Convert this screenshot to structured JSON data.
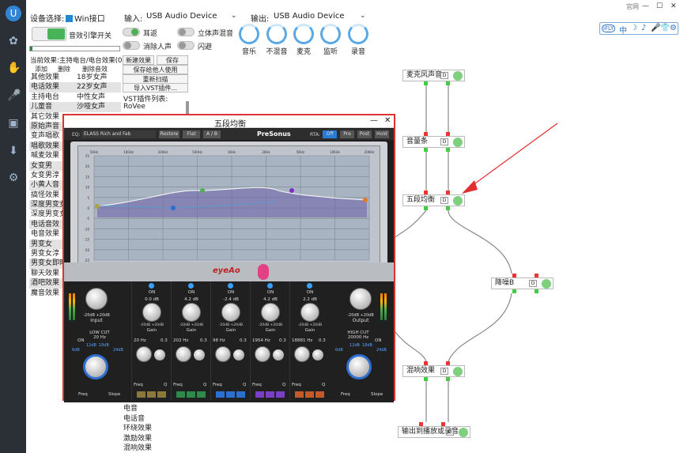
{
  "header": {
    "device_label": "设备选择:",
    "win_interface": "Win接口",
    "input_label": "输入:",
    "input_device": "USB Audio Device",
    "output_label": "输出:",
    "output_device": "USB Audio Device",
    "website_link": "官网"
  },
  "engine": {
    "switch_label": "音效引擎开关",
    "enabled": true
  },
  "toggles": [
    {
      "label": "耳返",
      "on": true
    },
    {
      "label": "立体声混音",
      "on": false
    },
    {
      "label": "消除人声",
      "on": false
    },
    {
      "label": "闪避",
      "on": false
    }
  ],
  "knobs": [
    "音乐",
    "不混音",
    "麦克",
    "监听",
    "录音"
  ],
  "progress": 0.03,
  "current_effect": {
    "label": "当前效果:",
    "value": "主持电台/电台效果(04)"
  },
  "effect_actions": [
    "添加",
    "删除",
    "删除音效"
  ],
  "plugin_buttons": {
    "new_effect": "新建效果",
    "save": "保存",
    "save_for_others": "保存给他人使用",
    "rescan": "重新扫描",
    "import_vst": "导入VST插件...",
    "vst_list_label": "VST插件列表:",
    "vst_first": "RoVee"
  },
  "effects_col1": [
    "其他效果",
    "电话效果",
    "主持电台",
    "儿童音",
    "其它效果",
    "原始声音",
    "变声唱歌",
    "唱歌效果",
    "喊麦效果",
    "女变男",
    "女变男淳",
    "小黄人音",
    "搞怪效果",
    "深度男变女",
    "深度男变女",
    "电话音效",
    "电音效果",
    "男变女",
    "男变女淳",
    "男变女即时",
    "聊天效果",
    "酒吧效果",
    "魔音效果"
  ],
  "effects_col2": [
    "18岁女声",
    "22岁女声",
    "中性女声",
    "沙哑女声"
  ],
  "effects_list2_bottom": [
    "电音",
    "电话音",
    "环绕效果",
    "激励效果",
    "混响效果"
  ],
  "top_tools": {
    "brand": "iFLY",
    "items": [
      "中",
      "☽",
      "♪",
      "🎤",
      "👕",
      "⚙"
    ]
  },
  "window_controls": [
    "—",
    "☐",
    "✕"
  ],
  "graph_nodes": [
    {
      "id": "mic",
      "label": "麦克风声音"
    },
    {
      "id": "vol",
      "label": "音量条"
    },
    {
      "id": "eq",
      "label": "五段均衡"
    },
    {
      "id": "nr",
      "label": "降噪B"
    },
    {
      "id": "reverb",
      "label": "混响效果"
    },
    {
      "id": "out",
      "label": "输出到播放或录音"
    }
  ],
  "node_badge": "D",
  "eq_window": {
    "title": "五段均衡",
    "eq_label": "EQ:",
    "preset": "ELASS Rich and Fab",
    "buttons": [
      "Restore",
      "Flat",
      "A / B"
    ],
    "brand": "PreSonus",
    "rta_label": "RTA:",
    "rta_buttons": [
      "Off",
      "Pre",
      "Post",
      "Hold"
    ],
    "logo": "eyeAo",
    "freq_ticks": [
      "50Hz",
      "100Hz",
      "200Hz",
      "500Hz",
      "1KHz",
      "2KHz",
      "5KHz",
      "10KHz",
      "20KHz"
    ],
    "db_ticks": [
      "25",
      "20",
      "15",
      "10",
      "5",
      "0",
      "-5",
      "-10",
      "-15",
      "-20",
      "-25"
    ],
    "input": {
      "label": "Input",
      "range": "-20dB  +20dB"
    },
    "output": {
      "label": "Output",
      "range": "-20dB  +20dB"
    },
    "low_cut": {
      "label": "LOW CUT",
      "freq": "20 Hz",
      "on": "ON",
      "slopes": [
        "6dB",
        "12dB",
        "18dB",
        "24dB"
      ],
      "freq_lbl": "Freq",
      "slope_lbl": "Slope"
    },
    "high_cut": {
      "label": "HIGH CUT",
      "freq": "20000 Hz",
      "on": "ON",
      "slopes": [
        "6dB",
        "12dB",
        "18dB",
        "24dB"
      ],
      "freq_lbl": "Freq",
      "slope_lbl": "Slope"
    },
    "bands": [
      {
        "on": "ON",
        "gain": "0.0 dB",
        "freq": "20 Hz",
        "q": "0.3"
      },
      {
        "on": "ON",
        "gain": "4.2 dB",
        "freq": "202 Hz",
        "q": "0.3"
      },
      {
        "on": "ON",
        "gain": "-2.4 dB",
        "freq": "98 Hz",
        "q": "0.3"
      },
      {
        "on": "ON",
        "gain": "4.2 dB",
        "freq": "1954 Hz",
        "q": "0.3"
      },
      {
        "on": "ON",
        "gain": "2.2 dB",
        "freq": "18881 Hz",
        "q": "0.3"
      }
    ],
    "gain_lbl": "Gain",
    "gain_range": "-20dB  +20dB",
    "freq_lbl": "Freq",
    "q_lbl": "Q"
  }
}
